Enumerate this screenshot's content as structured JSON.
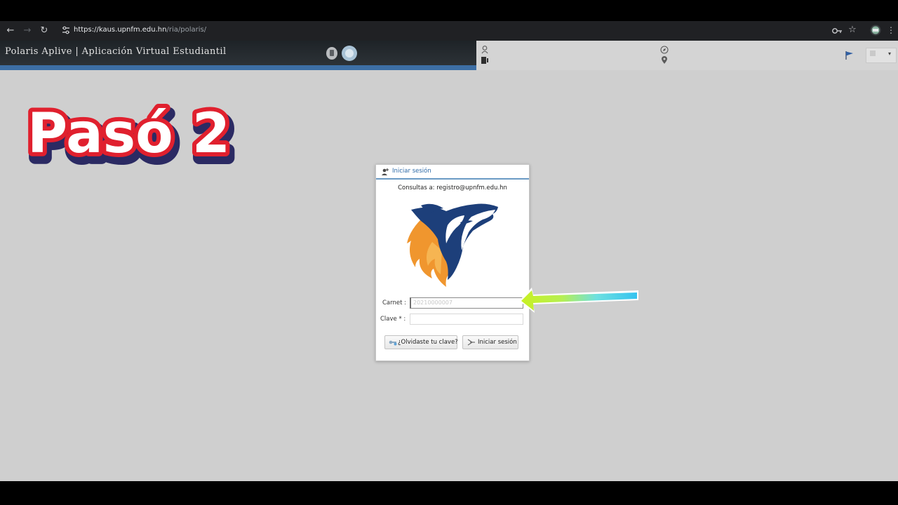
{
  "browser": {
    "url_host": "https://kaus.upnfm.edu.hn",
    "url_path": "/ria/polaris/"
  },
  "app": {
    "title": "Polaris Aplive | Aplicación Virtual Estudiantil"
  },
  "overlay": {
    "step_label": "Pasó 2"
  },
  "login": {
    "title": "Iniciar sesión",
    "contact": "Consultas a: registro@upnfm.edu.hn",
    "carnet_label": "Carnet :",
    "carnet_value": "20210000007",
    "clave_label": "Clave * :",
    "clave_value": "",
    "forgot_button": "¿Olvidaste tu clave?",
    "login_button": "Iniciar sesión"
  },
  "colors": {
    "accent_blue": "#3d6fa5",
    "overlay_red": "#e0202e",
    "overlay_navy": "#2b2a63"
  }
}
